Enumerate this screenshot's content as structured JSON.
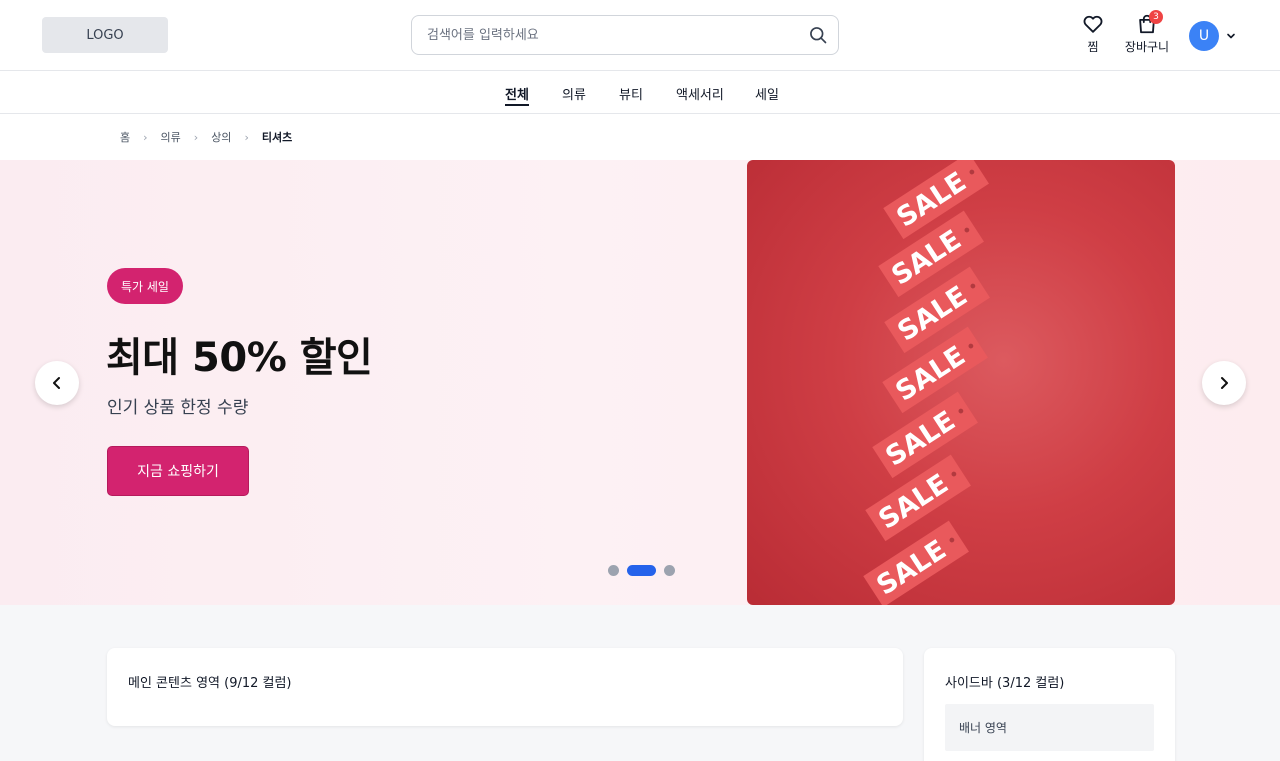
{
  "header": {
    "logo": "LOGO",
    "search_placeholder": "검색어를 입력하세요",
    "wishlist_label": "찜",
    "cart_label": "장바구니",
    "cart_count": "3",
    "user_initial": "U"
  },
  "nav": {
    "items": [
      {
        "label": "전체",
        "active": true
      },
      {
        "label": "의류"
      },
      {
        "label": "뷰티"
      },
      {
        "label": "액세서리"
      },
      {
        "label": "세일"
      }
    ]
  },
  "breadcrumb": [
    "홈",
    "의류",
    "상의",
    "티셔츠"
  ],
  "hero": {
    "badge": "특가 세일",
    "title": "최대 50% 할인",
    "subtitle": "인기 상품 한정 수량",
    "cta": "지금 쇼핑하기",
    "tag_text": "SALE",
    "slide_count": 3,
    "active_slide": 2,
    "accent_color": "#d3236f",
    "indicator_color": "#2563eb"
  },
  "main": {
    "title": "메인 콘텐츠 영역 (9/12 컬럼)"
  },
  "sidebar": {
    "title": "사이드바 (3/12 컬럼)",
    "banner": "배너 영역"
  }
}
